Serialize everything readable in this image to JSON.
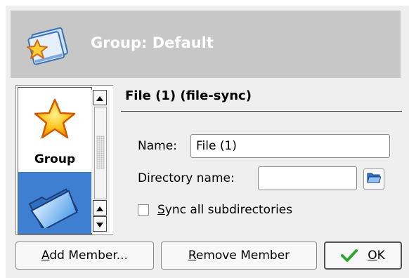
{
  "header": {
    "title": "Group: Default"
  },
  "icon_list": {
    "items": [
      {
        "label": "Group",
        "icon": "star-icon",
        "selected": false
      },
      {
        "label": "",
        "icon": "folder-icon",
        "selected": true
      }
    ]
  },
  "panel": {
    "section_title": "File (1)  (file-sync)",
    "name_label": "Name:",
    "name_value": "File (1)",
    "directory_label": "Directory name:",
    "directory_value": "",
    "sync_label_prefix": "S",
    "sync_label_rest": "ync all subdirectories",
    "sync_checked": false
  },
  "buttons": {
    "add_member_prefix": "A",
    "add_member_rest": "dd Member...",
    "remove_member_prefix": "R",
    "remove_member_rest": "emove Member",
    "ok_prefix": "O",
    "ok_rest": "K"
  },
  "colors": {
    "header_bg": "#c7c7c7",
    "selection": "#3f7fd1",
    "ok_check": "#2fa82f"
  }
}
